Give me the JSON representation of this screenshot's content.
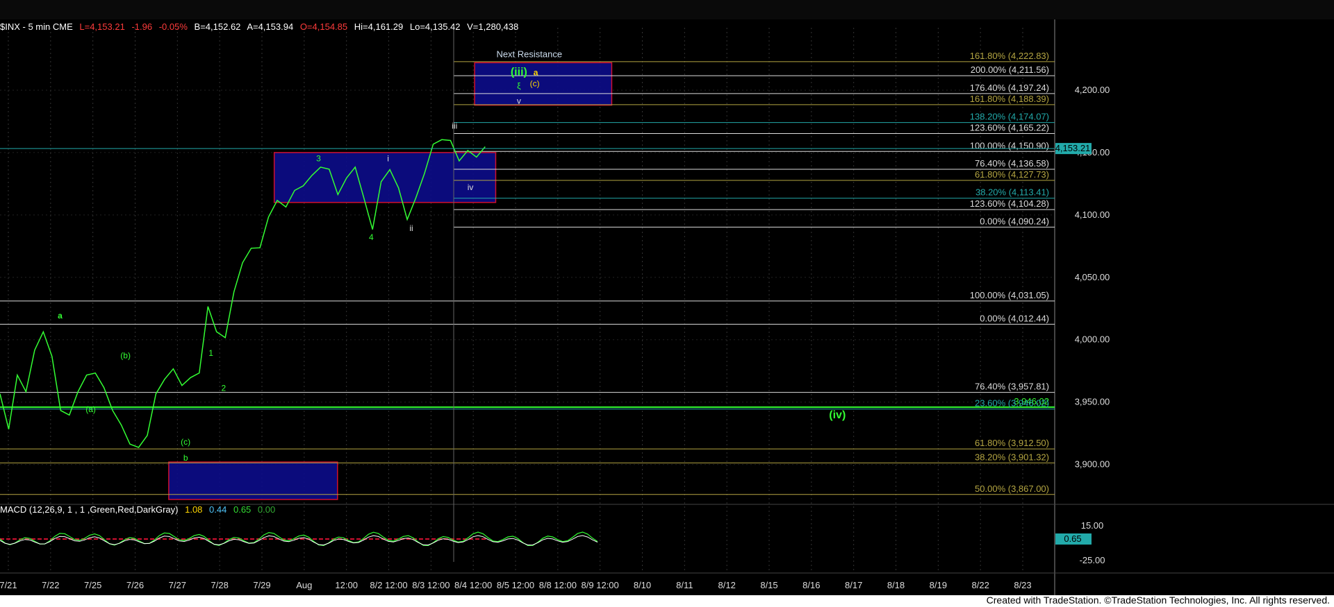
{
  "header": {
    "symbol": "$INX - 5 min  CME",
    "last": "L=4,153.21",
    "change": "-1.96",
    "pct": "-0.05%",
    "bid": "B=4,152.62",
    "ask": "A=4,153.94",
    "open": "O=4,154.85",
    "high": "Hi=4,161.29",
    "low": "Lo=4,135.42",
    "volume": "V=1,280,438"
  },
  "macd": {
    "label": "MACD (12,26,9, 1 , 1 ,Green,Red,DarkGray)",
    "v1": "1.08",
    "v2": "0.44",
    "v3": "0.65",
    "v4": "0.00",
    "axis": [
      "15.00",
      "-25.00"
    ],
    "current": "0.65"
  },
  "credit": "Created with TradeStation. ©TradeStation Technologies, Inc. All rights reserved.",
  "chart_data": {
    "type": "line",
    "x_labels": [
      "7/21",
      "7/22",
      "7/25",
      "7/26",
      "7/27",
      "7/28",
      "7/29",
      "Aug",
      "12:00",
      "8/2 12:00",
      "8/3 12:00",
      "8/4 12:00",
      "8/5 12:00",
      "8/8 12:00",
      "8/9 12:00",
      "8/10",
      "8/11",
      "8/12",
      "8/15",
      "8/16",
      "8/17",
      "8/18",
      "8/19",
      "8/22",
      "8/23"
    ],
    "y_ticks": [
      3900,
      3950,
      4000,
      4050,
      4100,
      4150,
      4200
    ],
    "y_tick_labels": [
      "3,900.00",
      "3,950.00",
      "4,000.00",
      "4,050.00",
      "4,100.00",
      "4,150.00",
      "4,200.00"
    ],
    "ylim": [
      3872,
      4250
    ],
    "current_price": 4153.21,
    "current_price_label": "4,153.21",
    "series": [
      {
        "color": "#33ff33",
        "values": [
          3955,
          3930,
          3970,
          3960,
          3990,
          4008,
          3985,
          3945,
          3938,
          3960,
          3970,
          3975,
          3960,
          3945,
          3930,
          3918,
          3912,
          3925,
          3955,
          3970,
          3975,
          3965,
          3968,
          3975,
          4025,
          4008,
          4000,
          4040,
          4060,
          4075,
          4072,
          4100,
          4110,
          4108,
          4118,
          4125,
          4130,
          4140,
          4135,
          4118,
          4128,
          4140,
          4112,
          4090,
          4125,
          4138,
          4120,
          4098,
          4112,
          4135,
          4155,
          4162,
          4158,
          4145,
          4150,
          4148,
          4153
        ]
      }
    ],
    "fib_levels": [
      {
        "label": "161.80% (4,222.83)",
        "value": 4222.83,
        "color": "#b5a642"
      },
      {
        "label": "200.00% (4,211.56)",
        "value": 4211.56,
        "color": "#dddddd"
      },
      {
        "label": "176.40% (4,197.24)",
        "value": 4197.24,
        "color": "#dddddd"
      },
      {
        "label": "161.80% (4,188.39)",
        "value": 4188.39,
        "color": "#b5a642"
      },
      {
        "label": "138.20% (4,174.07)",
        "value": 4174.07,
        "color": "#22aaaa"
      },
      {
        "label": "123.60% (4,165.22)",
        "value": 4165.22,
        "color": "#dddddd"
      },
      {
        "label": "100.00% (4,150.90)",
        "value": 4150.9,
        "color": "#dddddd"
      },
      {
        "label": "76.40% (4,136.58)",
        "value": 4136.58,
        "color": "#dddddd"
      },
      {
        "label": "61.80% (4,127.73)",
        "value": 4127.73,
        "color": "#b5a642"
      },
      {
        "label": "38.20% (4,113.41)",
        "value": 4113.41,
        "color": "#22aaaa"
      },
      {
        "label": "123.60% (4,104.28)",
        "value": 4104.28,
        "color": "#dddddd"
      },
      {
        "label": "0.00% (4,090.24)",
        "value": 4090.24,
        "color": "#dddddd"
      },
      {
        "label": "100.00% (4,031.05)",
        "value": 4031.05,
        "color": "#dddddd"
      },
      {
        "label": "0.00% (4,012.44)",
        "value": 4012.44,
        "color": "#dddddd"
      },
      {
        "label": "76.40% (3,957.81)",
        "value": 3957.81,
        "color": "#dddddd"
      },
      {
        "label": "3,946.02",
        "value": 3946.02,
        "color": "#33ff33"
      },
      {
        "label": "23.60% (3,946.02)",
        "value": 3944.5,
        "color": "#22aaaa"
      },
      {
        "label": "61.80% (3,912.50)",
        "value": 3912.5,
        "color": "#b5a642"
      },
      {
        "label": "38.20% (3,901.32)",
        "value": 3901.32,
        "color": "#b5a642"
      },
      {
        "label": "50.00% (3,867.00)",
        "value": 3876,
        "color": "#b5a642"
      }
    ],
    "zones": [
      {
        "name": "resistance-zone",
        "label": "Next Resistance",
        "x0": 0.45,
        "x1": 0.58,
        "y0": 4188,
        "y1": 4222
      },
      {
        "name": "mid-zone",
        "label": "",
        "x0": 0.26,
        "x1": 0.47,
        "y0": 4110,
        "y1": 4150
      },
      {
        "name": "support-zone",
        "label": "",
        "x0": 0.16,
        "x1": 0.32,
        "y0": 3872,
        "y1": 3902
      }
    ],
    "wave_labels": [
      {
        "text": "a",
        "x": 0.057,
        "y": 4017,
        "color": "#33ff33"
      },
      {
        "text": "(a)",
        "x": 0.086,
        "y": 3942,
        "color": "#33ff33"
      },
      {
        "text": "(b)",
        "x": 0.119,
        "y": 3985,
        "color": "#33ff33"
      },
      {
        "text": "(c)",
        "x": 0.176,
        "y": 3916,
        "color": "#33ff33"
      },
      {
        "text": "b",
        "x": 0.176,
        "y": 3903,
        "color": "#33ff33"
      },
      {
        "text": "1",
        "x": 0.2,
        "y": 3987,
        "color": "#33ff33"
      },
      {
        "text": "2",
        "x": 0.212,
        "y": 3959,
        "color": "#33ff33"
      },
      {
        "text": "3",
        "x": 0.302,
        "y": 4143,
        "color": "#33ff33"
      },
      {
        "text": "4",
        "x": 0.352,
        "y": 4080,
        "color": "#33ff33"
      },
      {
        "text": "i",
        "x": 0.368,
        "y": 4143,
        "color": "#dddddd"
      },
      {
        "text": "ii",
        "x": 0.39,
        "y": 4087,
        "color": "#dddddd"
      },
      {
        "text": "iii",
        "x": 0.431,
        "y": 4169,
        "color": "#dddddd"
      },
      {
        "text": "iv",
        "x": 0.446,
        "y": 4120,
        "color": "#dddddd"
      },
      {
        "text": "v",
        "x": 0.492,
        "y": 4189,
        "color": "#dddddd"
      },
      {
        "text": "(iii)",
        "x": 0.492,
        "y": 4212,
        "color": "#33ff33"
      },
      {
        "text": "ξ",
        "x": 0.492,
        "y": 4201,
        "color": "#33ff33"
      },
      {
        "text": "a",
        "x": 0.508,
        "y": 4212,
        "color": "#ffd700"
      },
      {
        "text": "(c)",
        "x": 0.507,
        "y": 4203,
        "color": "#ffd700"
      },
      {
        "text": "(iv)",
        "x": 0.794,
        "y": 3937,
        "color": "#33ff33"
      }
    ]
  }
}
